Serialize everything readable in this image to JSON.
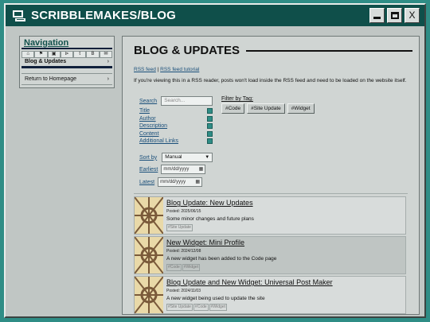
{
  "window": {
    "title": "SCRIBBLEMAKES/BLOG",
    "minimize_label": "",
    "maximize_label": "",
    "close_label": "X"
  },
  "sidebar": {
    "heading": "Navigation",
    "icons": [
      "home-icon",
      "flag-icon",
      "gallery-icon",
      "tag-icon",
      "tumblr-icon",
      "bluesky-icon",
      "mail-icon"
    ],
    "icon_glyphs": [
      "⌂",
      "⚑",
      "▣",
      "⊳",
      "t",
      "B",
      "✉"
    ],
    "items": [
      {
        "label": "Blog & Updates",
        "arrow": "›"
      },
      {
        "label": "Return to Homepage",
        "arrow": "›"
      }
    ]
  },
  "page": {
    "heading": "BLOG & UPDATES",
    "rss_feed": "RSS feed",
    "separator": "|",
    "rss_tutorial": "RSS feed tutorial",
    "note": "If you're viewing this in a RSS reader, posts won't load inside the RSS feed and need to be loaded on the website itself."
  },
  "filters": {
    "search_label": "Search",
    "search_placeholder": "Search...",
    "fields": [
      "Title",
      "Author",
      "Description",
      "Content",
      "Additional Links"
    ],
    "sort_label": "Sort by",
    "sort_value": "Manual",
    "earliest_label": "Earliest",
    "latest_label": "Latest",
    "date_placeholder": "mm/dd/yyyy",
    "tag_filter_label": "Filter by Tag:",
    "tags": [
      "#Code",
      "#Site Update",
      "#Widget"
    ]
  },
  "posts": [
    {
      "title": "Blog Update: New Updates",
      "date": "Posted: 2025/06/15",
      "description": "Some minor changes and future plans",
      "tags": [
        "#Site Update"
      ]
    },
    {
      "title": "New Widget: Mini Profile",
      "date": "Posted: 2024/12/08",
      "description": "A new widget has been added to the Code page",
      "tags": [
        "#Code",
        "#Widget"
      ]
    },
    {
      "title": "Blog Update and New Widget: Universal Post Maker",
      "date": "Posted: 2024/11/03",
      "description": "A new widget being used to update the site",
      "tags": [
        "#Site Update",
        "#Code",
        "#Widget"
      ]
    }
  ],
  "colors": {
    "desktop": "#2f8d86",
    "titlebar": "#0f4f4a",
    "link": "#1a4f7a",
    "thumb_bg": "#e9d9a8",
    "thumb_art": "#7a5a3a"
  }
}
